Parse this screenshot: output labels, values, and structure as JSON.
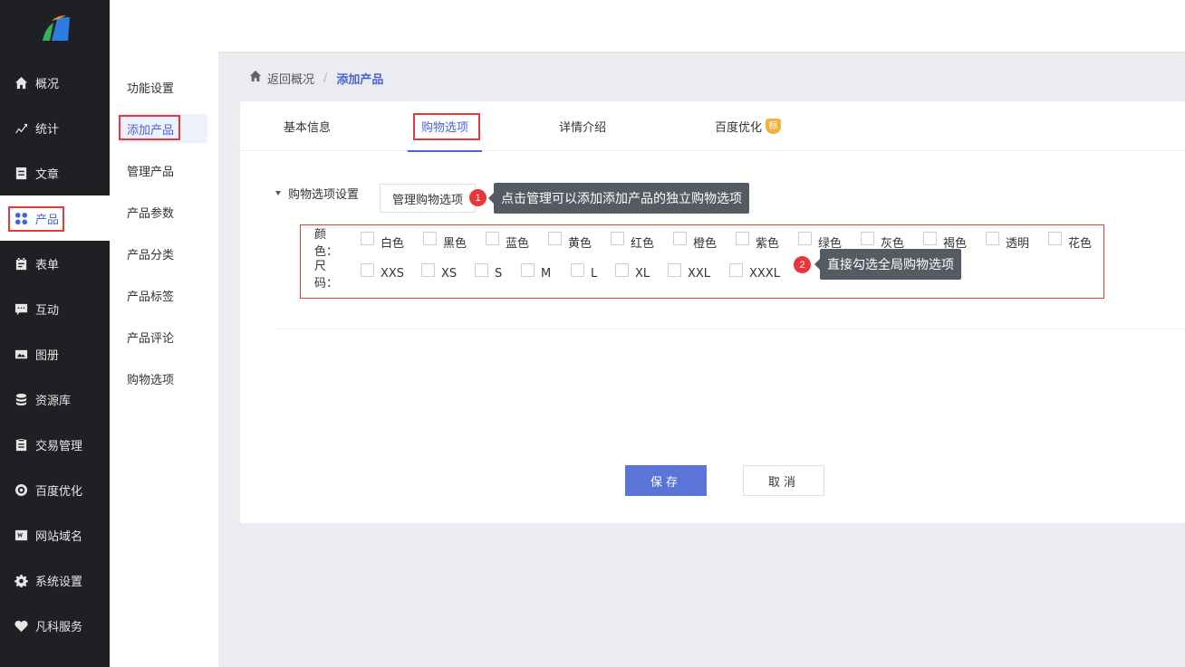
{
  "sidebar": {
    "items": [
      {
        "label": "概况",
        "icon": "home-icon"
      },
      {
        "label": "统计",
        "icon": "chart-icon"
      },
      {
        "label": "文章",
        "icon": "article-icon"
      },
      {
        "label": "产品",
        "icon": "grid-icon",
        "active": true
      },
      {
        "label": "表单",
        "icon": "form-icon"
      },
      {
        "label": "互动",
        "icon": "chat-icon"
      },
      {
        "label": "图册",
        "icon": "album-icon"
      },
      {
        "label": "资源库",
        "icon": "database-icon"
      },
      {
        "label": "交易管理",
        "icon": "clipboard-icon"
      },
      {
        "label": "百度优化",
        "icon": "seo-icon"
      },
      {
        "label": "网站域名",
        "icon": "domain-icon"
      },
      {
        "label": "系统设置",
        "icon": "gear-icon"
      },
      {
        "label": "凡科服务",
        "icon": "heart-icon"
      }
    ]
  },
  "submenu": {
    "items": [
      "功能设置",
      "添加产品",
      "管理产品",
      "产品参数",
      "产品分类",
      "产品标签",
      "产品评论",
      "购物选项"
    ]
  },
  "breadcrumb": {
    "back": "返回概况",
    "separator": "/",
    "current": "添加产品"
  },
  "tabs": [
    "基本信息",
    "购物选项",
    "详情介绍",
    "百度优化"
  ],
  "tab_badge": "标",
  "section": {
    "label": "购物选项设置",
    "manage_button": "管理购物选项"
  },
  "callouts": [
    {
      "num": "1",
      "text": "点击管理可以添加添加产品的独立购物选项"
    },
    {
      "num": "2",
      "text": "直接勾选全局购物选项"
    }
  ],
  "options": {
    "color_label": "颜色：",
    "colors": [
      "白色",
      "黑色",
      "蓝色",
      "黄色",
      "红色",
      "橙色",
      "紫色",
      "绿色",
      "灰色",
      "褐色",
      "透明",
      "花色"
    ],
    "size_label": "尺码：",
    "sizes": [
      "XXS",
      "XS",
      "S",
      "M",
      "L",
      "XL",
      "XXL",
      "XXXL"
    ]
  },
  "buttons": {
    "save": "保存",
    "cancel": "取消"
  },
  "colors": {
    "accent": "#4a63d8",
    "sidebar_bg": "#1f2023",
    "highlight": "#e03c3c"
  }
}
